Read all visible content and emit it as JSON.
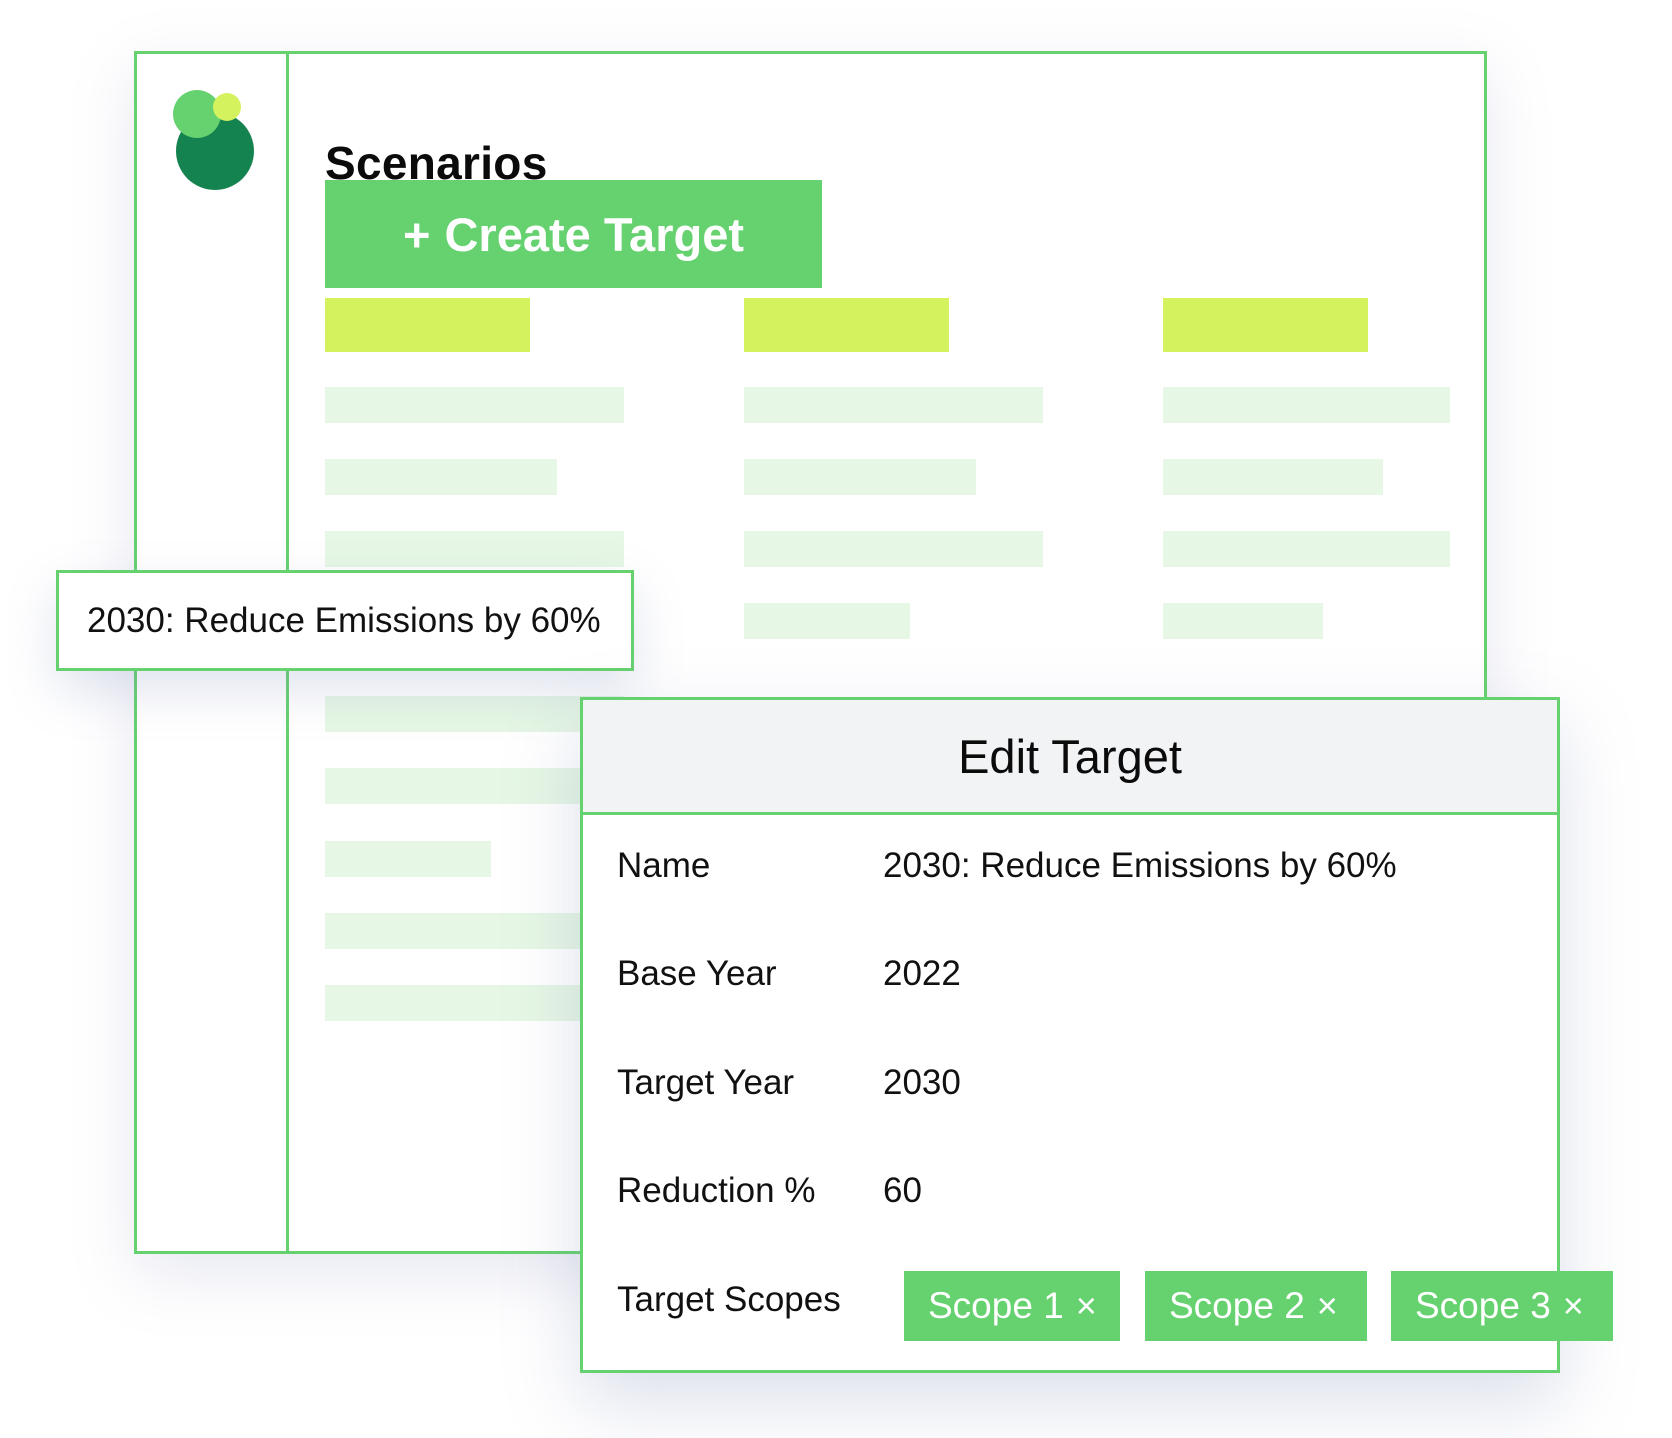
{
  "app": {
    "page_title": "Scenarios",
    "create_button_icon": "+",
    "create_button_label": "Create Target"
  },
  "selected_card": {
    "text": "2030: Reduce Emissions by 60%"
  },
  "dialog": {
    "title": "Edit Target",
    "fields": {
      "name": {
        "label": "Name",
        "value": "2030: Reduce Emissions by 60%"
      },
      "base_year": {
        "label": "Base Year",
        "value": "2022"
      },
      "target_year": {
        "label": "Target Year",
        "value": "2030"
      },
      "reduction": {
        "label": "Reduction %",
        "value": "60"
      },
      "scopes": {
        "label": "Target Scopes"
      }
    },
    "scope_chips": [
      {
        "label": "Scope 1",
        "remove_icon": "×"
      },
      {
        "label": "Scope 2",
        "remove_icon": "×"
      },
      {
        "label": "Scope 3",
        "remove_icon": "×"
      }
    ]
  },
  "colors": {
    "accent_green": "#66d16f",
    "lime": "#d3f25e",
    "dark_green": "#15834f",
    "placeholder": "#e6f7e5"
  },
  "icons": {
    "logo": "circles-logo-icon",
    "chip_remove": "close-icon"
  }
}
